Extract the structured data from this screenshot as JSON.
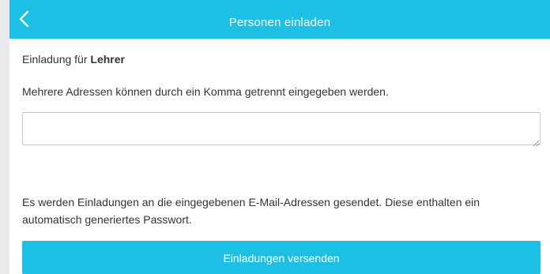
{
  "header": {
    "title": "Personen einladen",
    "back_icon": "chevron-left-icon"
  },
  "invitation": {
    "label": "Einladung für",
    "role": "Lehrer"
  },
  "hint": "Mehrere Adressen können durch ein Komma getrennt eingegeben werden.",
  "email_field": {
    "value": "",
    "placeholder": ""
  },
  "notice": "Es werden Einladungen an die eingegebenen E-Mail-Adressen gesendet. Diese enthalten ein automatisch generiertes Passwort.",
  "send_button": {
    "label": "Einladungen versenden"
  },
  "colors": {
    "accent": "#1dc0e4",
    "text": "#333333",
    "page_background": "#e9eaec"
  }
}
